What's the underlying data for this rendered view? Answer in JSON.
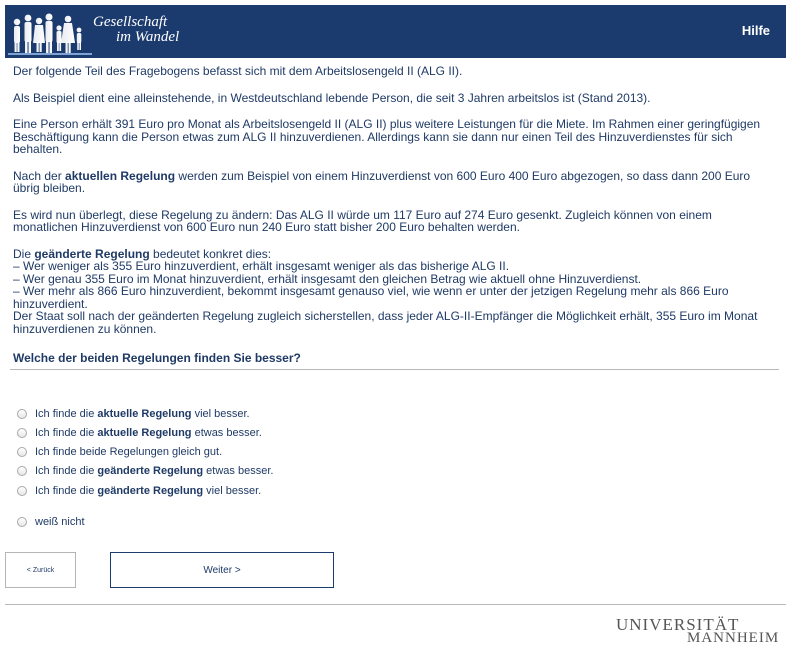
{
  "header": {
    "logo_line1": "Gesellschaft",
    "logo_line2": "im Wandel",
    "help_label": "Hilfe"
  },
  "body": {
    "p1": "Der folgende Teil des Fragebogens befasst sich mit dem Arbeitslosengeld II (ALG II).",
    "p2": "Als Beispiel dient eine alleinstehende, in Westdeutschland lebende Person, die seit 3 Jahren arbeitslos ist (Stand 2013).",
    "p3": "Eine Person erhält 391 Euro pro Monat als Arbeitslosengeld II (ALG II) plus weitere Leistungen für die Miete. Im Rahmen einer geringfügigen Beschäftigung kann die Person etwas zum ALG II hinzuverdienen. Allerdings kann sie dann nur einen Teil des Hinzuverdienstes für sich behalten.",
    "p4_pre": "Nach der ",
    "p4_bold": "aktuellen Regelung",
    "p4_post": " werden zum Beispiel von einem Hinzuverdienst von 600 Euro 400 Euro abgezogen, so dass dann 200 Euro übrig bleiben.",
    "p5": "Es wird nun überlegt, diese Regelung zu ändern: Das ALG II würde um 117 Euro auf 274 Euro gesenkt. Zugleich können von einem monatlichen Hinzuverdienst von 600 Euro nun 240 Euro statt bisher 200 Euro behalten werden.",
    "p6_pre": "Die ",
    "p6_bold": "geänderte Regelung",
    "p6_post": " bedeutet konkret dies:",
    "b1": "– Wer weniger als 355 Euro hinzuverdient, erhält insgesamt weniger als das bisherige ALG II.",
    "b2": "– Wer genau 355 Euro im Monat hinzuverdient, erhält insgesamt den gleichen Betrag wie aktuell ohne Hinzuverdienst.",
    "b3": "– Wer mehr als 866 Euro hinzuverdient, bekommt insgesamt genauso viel, wie wenn er unter der jetzigen Regelung mehr als 866 Euro hinzuverdient.",
    "p7": "Der Staat soll nach der geänderten Regelung zugleich sicherstellen, dass jeder ALG-II-Empfänger die Möglichkeit erhält, 355 Euro im Monat hinzuverdienen zu können."
  },
  "question": "Welche der beiden Regelungen finden Sie besser?",
  "options": [
    {
      "pre": "Ich finde die ",
      "bold": "aktuelle Regelung",
      "post": " viel besser."
    },
    {
      "pre": "Ich finde die ",
      "bold": "aktuelle Regelung",
      "post": " etwas besser."
    },
    {
      "pre": "Ich finde beide Regelungen gleich gut.",
      "bold": "",
      "post": ""
    },
    {
      "pre": "Ich finde die ",
      "bold": "geänderte Regelung",
      "post": " etwas besser."
    },
    {
      "pre": "Ich finde die ",
      "bold": "geänderte Regelung",
      "post": " viel besser."
    },
    {
      "pre": "weiß nicht",
      "bold": "",
      "post": ""
    }
  ],
  "nav": {
    "back_label": "< Zurück",
    "next_label": "Weiter >"
  },
  "footer": {
    "uni_line1": "UNIVERSITÄT",
    "uni_line2": "MANNHEIM"
  },
  "colors": {
    "header_bg": "#1b3a6e",
    "text": "#1f3a66"
  }
}
